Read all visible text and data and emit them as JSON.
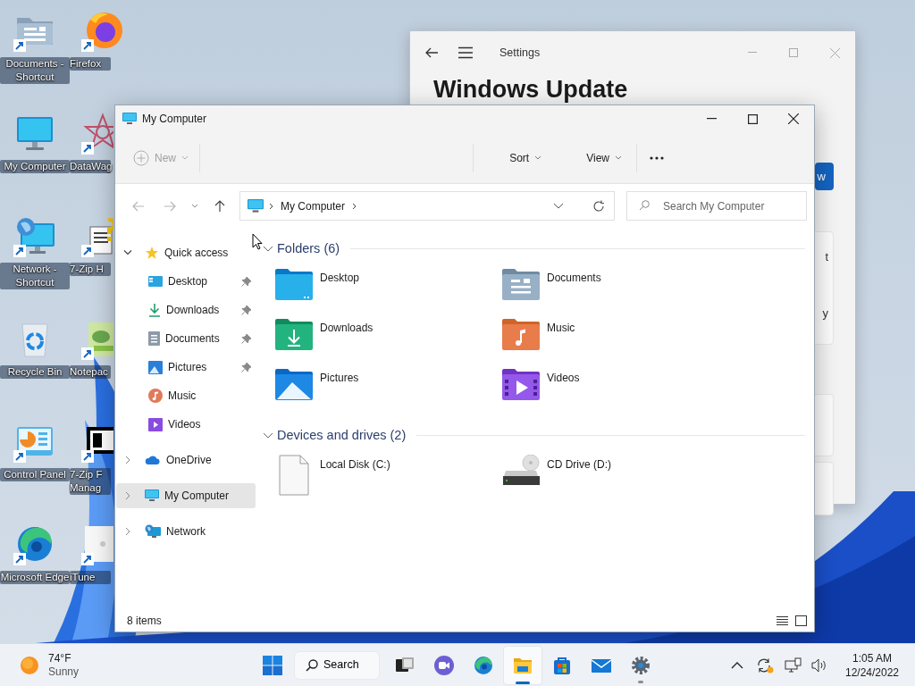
{
  "desktop": {
    "icons": [
      {
        "label": "Documents - Shortcut",
        "shortcut": true
      },
      {
        "label": "Firefox",
        "shortcut": true
      },
      {
        "label": "My Computer",
        "shortcut": false
      },
      {
        "label": "DataWag",
        "shortcut": true
      },
      {
        "label": "Network - Shortcut",
        "shortcut": true
      },
      {
        "label": "7-Zip H",
        "shortcut": true
      },
      {
        "label": "Recycle Bin",
        "shortcut": false
      },
      {
        "label": "Notepac",
        "shortcut": true
      },
      {
        "label": "Control Panel",
        "shortcut": true
      },
      {
        "label": "7-Zip F Manag",
        "shortcut": true
      },
      {
        "label": "Microsoft Edge",
        "shortcut": true
      },
      {
        "label": "iTune",
        "shortcut": true
      }
    ]
  },
  "settings_window": {
    "title": "Settings",
    "heading": "Windows Update",
    "button_text": "w",
    "card_texts": [
      "t",
      "y"
    ]
  },
  "explorer": {
    "title": "My Computer",
    "toolbar": {
      "new": {
        "label": "New",
        "disabled": true
      },
      "sort": {
        "label": "Sort"
      },
      "view": {
        "label": "View"
      }
    },
    "navigation": {
      "back": {
        "disabled": true
      },
      "forward": {
        "disabled": true
      },
      "up": {
        "disabled": false
      }
    },
    "address": {
      "path": [
        "My Computer"
      ]
    },
    "search": {
      "placeholder": "Search My Computer"
    },
    "sidebar": {
      "items": [
        {
          "label": "Quick access",
          "expanded": true,
          "selected": false,
          "children": [
            {
              "label": "Desktop",
              "pinned": true,
              "selected": false
            },
            {
              "label": "Downloads",
              "pinned": true,
              "selected": false
            },
            {
              "label": "Documents",
              "pinned": true,
              "selected": false
            },
            {
              "label": "Pictures",
              "pinned": true,
              "selected": false
            },
            {
              "label": "Music",
              "pinned": false,
              "selected": false
            },
            {
              "label": "Videos",
              "pinned": false,
              "selected": false
            }
          ]
        },
        {
          "label": "OneDrive",
          "expanded": false,
          "selected": false
        },
        {
          "label": "My Computer",
          "expanded": false,
          "selected": true
        },
        {
          "label": "Network",
          "expanded": false,
          "selected": false
        }
      ]
    },
    "sections": [
      {
        "title": "Folders (6)",
        "expanded": true,
        "items": [
          {
            "label": "Desktop"
          },
          {
            "label": "Documents"
          },
          {
            "label": "Downloads"
          },
          {
            "label": "Music"
          },
          {
            "label": "Pictures"
          },
          {
            "label": "Videos"
          }
        ]
      },
      {
        "title": "Devices and drives (2)",
        "expanded": true,
        "items": [
          {
            "label": "Local Disk (C:)"
          },
          {
            "label": "CD Drive (D:)"
          }
        ]
      }
    ],
    "status_bar": {
      "item_count": "8 items"
    }
  },
  "taskbar": {
    "weather": {
      "temperature": "74°F",
      "condition": "Sunny"
    },
    "search": {
      "label": "Search"
    },
    "apps": [
      {
        "running": false,
        "active": false
      },
      {
        "running": false,
        "active": false
      },
      {
        "running": false,
        "active": false
      },
      {
        "running": true,
        "active": true
      },
      {
        "running": false,
        "active": false
      },
      {
        "running": false,
        "active": false
      },
      {
        "running": true,
        "active": false
      }
    ],
    "clock": {
      "time": "1:05 AM",
      "date": "12/24/2022"
    }
  }
}
